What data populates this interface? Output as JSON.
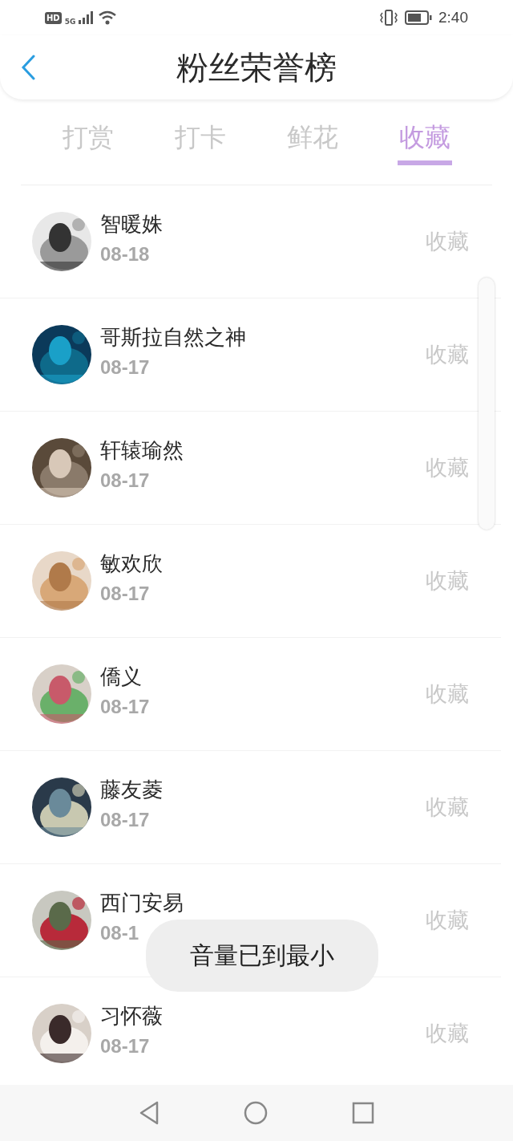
{
  "status_bar": {
    "hd": "HD",
    "network": "5G",
    "time": "2:40"
  },
  "header": {
    "title": "粉丝荣誉榜"
  },
  "tabs": [
    {
      "label": "打赏",
      "selected": false
    },
    {
      "label": "打卡",
      "selected": false
    },
    {
      "label": "鲜花",
      "selected": false
    },
    {
      "label": "收藏",
      "selected": true
    }
  ],
  "rows": [
    {
      "name": "智暖姝",
      "date": "08-18",
      "action": "收藏"
    },
    {
      "name": "哥斯拉自然之神",
      "date": "08-17",
      "action": "收藏"
    },
    {
      "name": "轩辕瑜然",
      "date": "08-17",
      "action": "收藏"
    },
    {
      "name": "敏欢欣",
      "date": "08-17",
      "action": "收藏"
    },
    {
      "name": "僑义",
      "date": "08-17",
      "action": "收藏"
    },
    {
      "name": "藤友菱",
      "date": "08-17",
      "action": "收藏"
    },
    {
      "name": "西门安易",
      "date": "08-1",
      "action": "收藏"
    },
    {
      "name": "习怀薇",
      "date": "08-17",
      "action": "收藏"
    }
  ],
  "toast": {
    "text": "音量已到最小"
  }
}
